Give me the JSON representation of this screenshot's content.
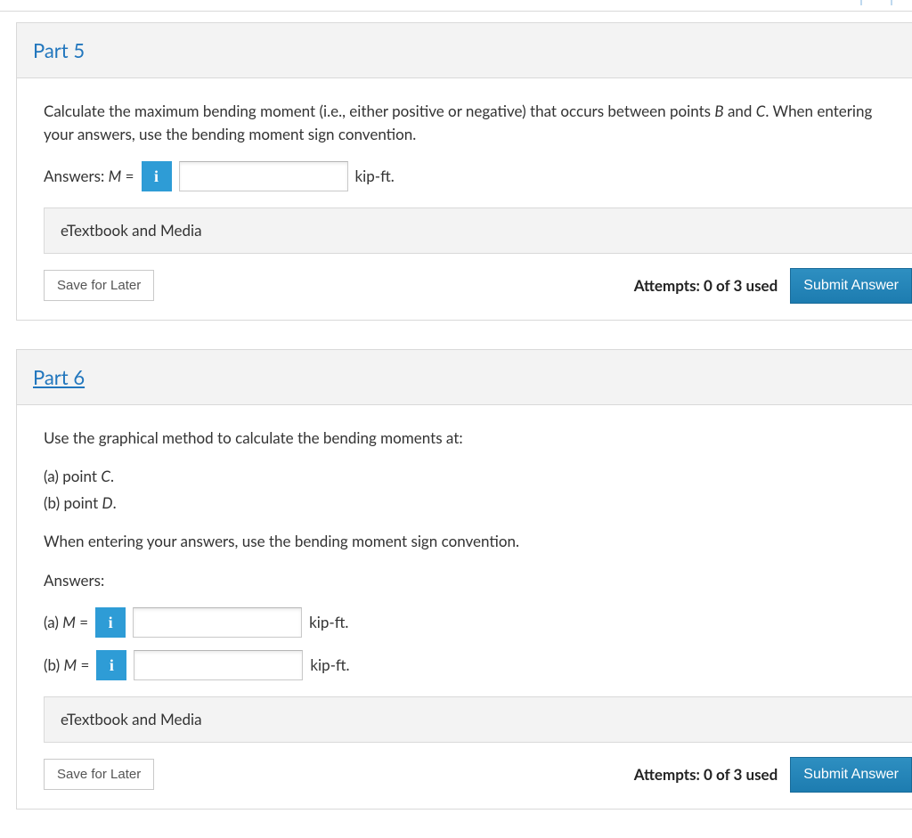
{
  "icons": {
    "info": "i"
  },
  "part5": {
    "title": "Part 5",
    "instruction_pre": "Calculate the maximum bending moment (i.e., either positive or negative) that occurs between points ",
    "point_b": "B",
    "instruction_mid1": " and ",
    "point_c": "C",
    "instruction_post": ". When entering your answers, use the bending moment sign convention.",
    "answer_label_pre": "Answers: ",
    "answer_var": "M",
    "answer_label_post": " = ",
    "unit": "kip-ft.",
    "etextbook": "eTextbook and Media",
    "save": "Save for Later",
    "attempts": "Attempts: 0 of 3 used",
    "submit": "Submit Answer"
  },
  "part6": {
    "title": "Part 6",
    "line1": "Use the graphical method to calculate the bending moments at:",
    "a_pre": "(a) point ",
    "a_pt": "C",
    "a_post": ".",
    "b_pre": "(b) point ",
    "b_pt": "D",
    "b_post": ".",
    "line2": "When entering your answers, use the bending moment sign convention.",
    "answers_label": "Answers:",
    "row_a_pre": "(a) ",
    "row_b_pre": "(b) ",
    "var": "M",
    "eq": " = ",
    "unit": "kip-ft.",
    "etextbook": "eTextbook and Media",
    "save": "Save for Later",
    "attempts": "Attempts: 0 of 3 used",
    "submit": "Submit Answer"
  }
}
